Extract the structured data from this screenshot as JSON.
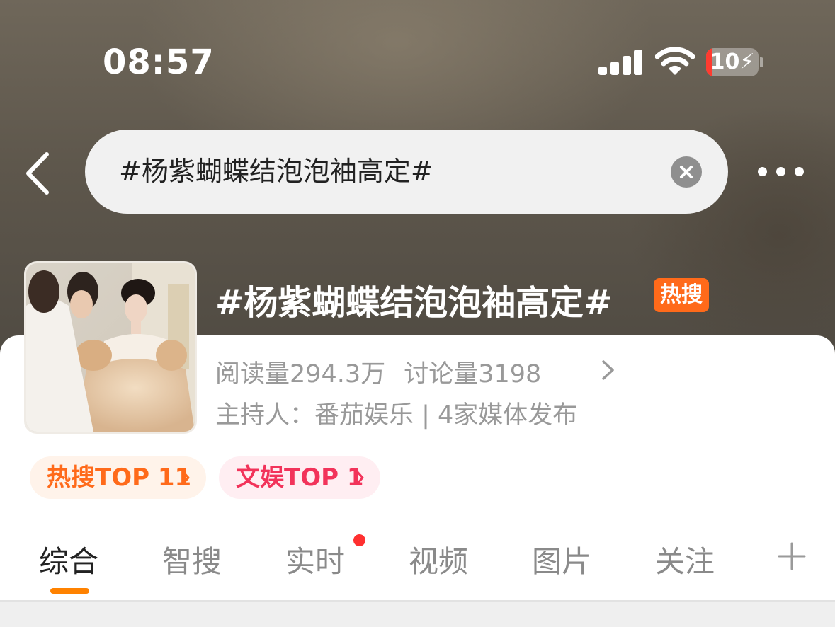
{
  "status_bar": {
    "time": "08:57",
    "battery": "10",
    "battery_level": 0.1
  },
  "search": {
    "query": "#杨紫蝴蝶结泡泡袖高定#"
  },
  "topic": {
    "title": "#杨紫蝴蝶结泡泡袖高定#",
    "hot_badge": "热搜",
    "reads": "阅读量294.3万",
    "discussions": "讨论量3198",
    "host": "主持人：番茄娱乐 | 4家媒体发布"
  },
  "ranks": {
    "hot": "热搜TOP 11",
    "entertainment": "文娱TOP 1"
  },
  "tabs": [
    {
      "label": "综合",
      "active": true
    },
    {
      "label": "智搜"
    },
    {
      "label": "实时",
      "badge": "dot"
    },
    {
      "label": "视频"
    },
    {
      "label": "图片"
    },
    {
      "label": "关注"
    }
  ],
  "colors": {
    "accent": "#ff8200",
    "hot": "#ff6a1a",
    "ent": "#f2335a"
  },
  "icons": [
    "back-arrow-icon",
    "clear-icon",
    "more-icon",
    "cellular-signal-icon",
    "wifi-icon",
    "battery-charging-icon",
    "chevron-right-icon",
    "plus-icon"
  ]
}
